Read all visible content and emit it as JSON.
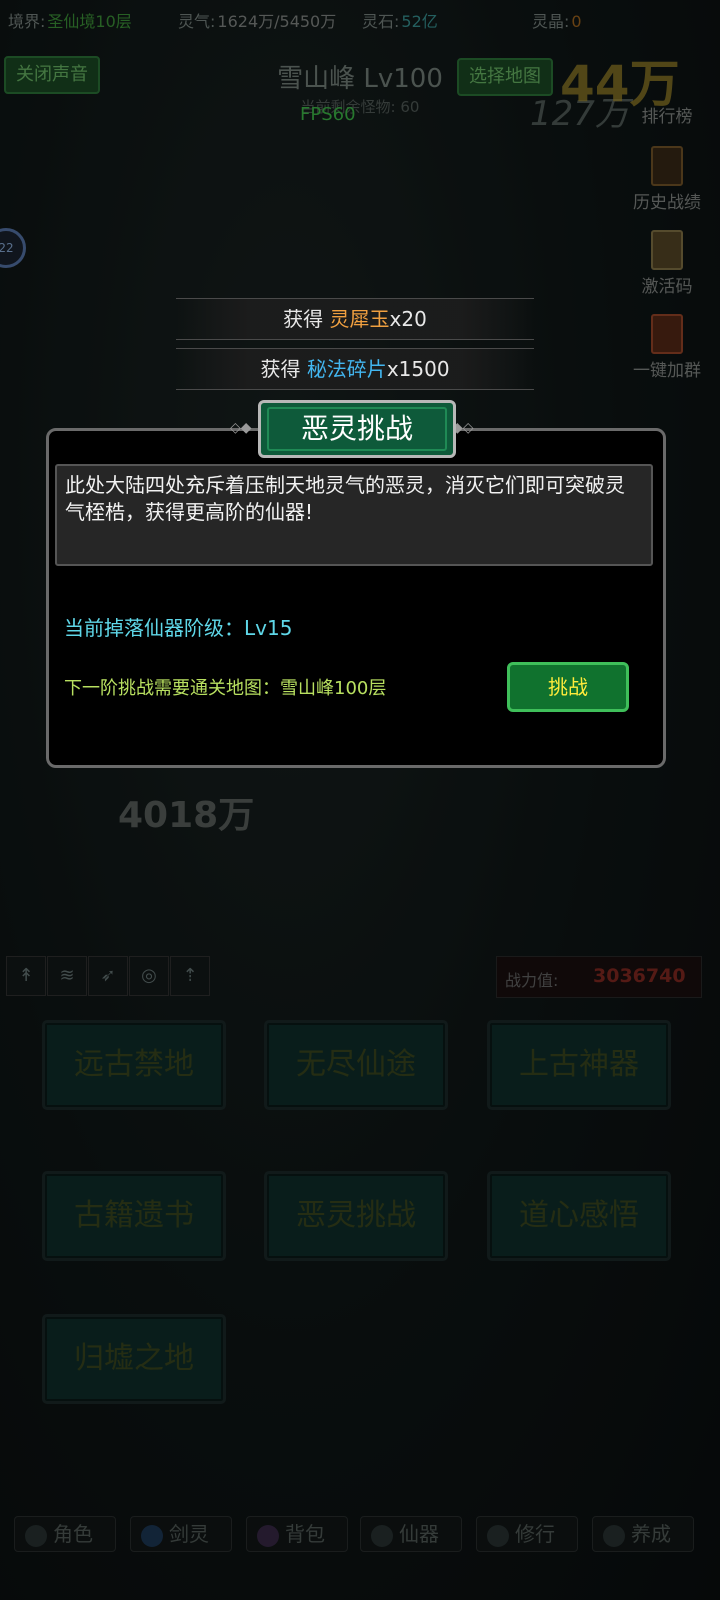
{
  "status_bar": {
    "realm_label": "境界:",
    "realm_value": "圣仙境10层",
    "qi_label": "灵气:",
    "qi_value": "1624万/5450万",
    "stone_label": "灵石:",
    "stone_value": "52亿",
    "crystal_label": "灵晶:",
    "crystal_value": "0"
  },
  "header": {
    "mute_button": "关闭声音",
    "map_title": "雪山峰 Lv100",
    "map_sub": "当前剩余怪物: 60",
    "fps": "FPS60",
    "select_map_button": "选择地图",
    "big_number": "44万",
    "big_number_sub": "127万"
  },
  "side_menu": [
    {
      "label": "排行榜",
      "icon": "trophy-icon"
    },
    {
      "label": "历史战绩",
      "icon": "scroll-icon"
    },
    {
      "label": "激活码",
      "icon": "book-icon"
    },
    {
      "label": "一键加群",
      "icon": "tome-icon"
    }
  ],
  "badge": "22",
  "toasts": [
    {
      "prefix": "获得 ",
      "item": "灵犀玉",
      "qty": "x20"
    },
    {
      "prefix": "获得 ",
      "item": "秘法碎片",
      "qty": "x1500"
    }
  ],
  "modal": {
    "title": "恶灵挑战",
    "description": "此处大陆四处充斥着压制天地灵气的恶灵，消灭它们即可突破灵气桎梏，获得更高阶的仙器!",
    "current_level": "当前掉落仙器阶级：Lv15",
    "next_requirement": "下一阶挑战需要通关地图：雪山峰100层",
    "challenge_button": "挑战"
  },
  "damage_float": "4018万",
  "power": {
    "label": "战力值:",
    "value": "3036740"
  },
  "menu_grid": [
    "远古禁地",
    "无尽仙途",
    "上古神器",
    "古籍遗书",
    "恶灵挑战",
    "道心感悟",
    "归墟之地"
  ],
  "bottom_nav": [
    {
      "label": "角色",
      "icon": "character-icon"
    },
    {
      "label": "剑灵",
      "icon": "sword-spirit-icon"
    },
    {
      "label": "背包",
      "icon": "bag-icon"
    },
    {
      "label": "仙器",
      "icon": "artifact-icon"
    },
    {
      "label": "修行",
      "icon": "cultivate-icon"
    },
    {
      "label": "养成",
      "icon": "growth-icon"
    }
  ],
  "colors": {
    "accent_green": "#10722e",
    "item_gold": "#f0a040",
    "item_blue": "#42b6f0",
    "level_cyan": "#5fd7e8",
    "requirement_lime": "#b8e060",
    "power_red": "#8a2a22"
  }
}
